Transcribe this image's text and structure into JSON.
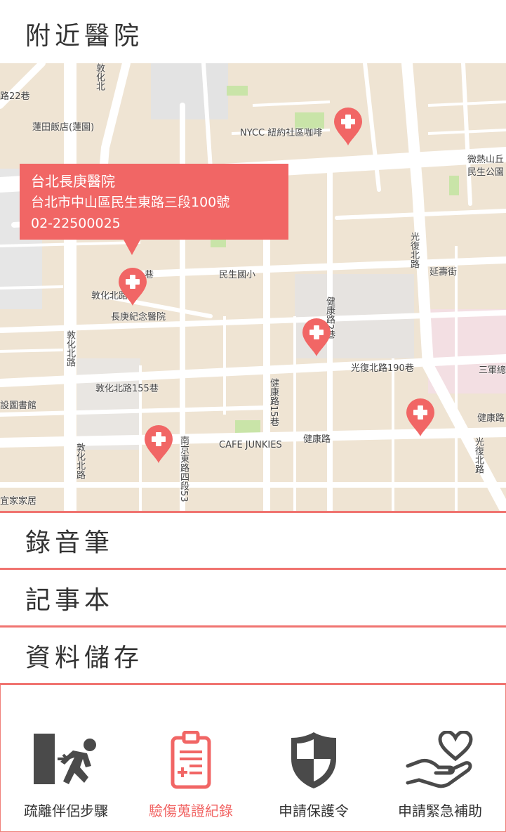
{
  "header": {
    "title": "附近醫院"
  },
  "map": {
    "labels": {
      "lotus_hotel": "蓮田飯店(蓮園)",
      "nycc": "NYCC 紐約社區咖啡",
      "minsheng_school": "民生國小",
      "changgung_memorial": "長庚紀念醫院",
      "dunhua_155": "敦化北路155巷",
      "guangfu_190": "光復北路190巷",
      "cafe_junkies": "CAFE JUNKIES",
      "jiankang_rd": "健康路",
      "jiankang_rd_east": "健康路",
      "yanshou_st": "延壽街",
      "library": "設圖書館",
      "yijia": "宜家家居",
      "sanjun": "三軍總",
      "weire": "微熱山丘",
      "minsheng_park": "民生公園",
      "lane22": "路22巷",
      "dunhua_n_rd_v": "敦化北路",
      "dunhua_n_rd_v2": "敦化北路",
      "guangfu_n_rd_v": "光復北路",
      "guangfu_n_rd_v2": "光復北路",
      "jiankang_lane15": "健康路15巷",
      "nanjing_e_53": "南京東路四段53",
      "jiankang_lane_v": "健康路2巷",
      "dunhua_top": "敦化北",
      "dunhua_lane": "敦化北路",
      "lane_label": "巷"
    },
    "callout": {
      "name": "台北長庚醫院",
      "address": "台北市中山區民生東路三段100號",
      "phone": "02-22500025"
    },
    "colors": {
      "pin": "#f16665",
      "land": "#efe4d3",
      "road": "#ffffff",
      "park": "#c9e4a8"
    }
  },
  "menu": {
    "recorder": "錄音筆",
    "notebook": "記事本",
    "storage": "資料儲存"
  },
  "nav": {
    "items": [
      {
        "label": "疏離伴侶步驟",
        "icon": "escape-door-icon"
      },
      {
        "label": "驗傷蒐證紀錄",
        "icon": "clipboard-medical-icon"
      },
      {
        "label": "申請保護令",
        "icon": "shield-icon"
      },
      {
        "label": "申請緊急補助",
        "icon": "hand-heart-icon"
      }
    ],
    "active_color": "#f16665",
    "icon_color": "#4a4a4a"
  }
}
